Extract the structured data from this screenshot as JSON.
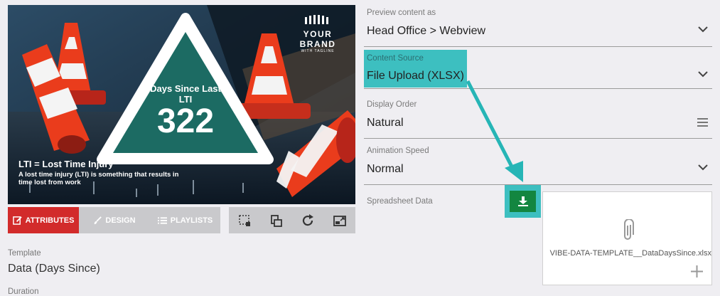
{
  "preview": {
    "brand_name": "YOUR BRAND",
    "brand_tagline": "WITH TAGLINE",
    "triangle_title": "Days Since Last LTI",
    "triangle_value": "322",
    "footer_heading": "LTI = Lost Time Injury",
    "footer_text": "A lost time injury (LTI) is something that results in time lost from work"
  },
  "tabs": [
    {
      "label": "ATTRIBUTES",
      "icon": "edit-icon",
      "active": true
    },
    {
      "label": "DESIGN",
      "icon": "brush-icon",
      "active": false
    },
    {
      "label": "PLAYLISTS",
      "icon": "list-icon",
      "active": false
    }
  ],
  "tools": [
    "crop-icon",
    "layers-icon",
    "refresh-icon",
    "fullscreen-icon"
  ],
  "template": {
    "label": "Template",
    "value": "Data (Days Since)"
  },
  "duration": {
    "label": "Duration"
  },
  "settings": {
    "preview_as": {
      "label": "Preview content as",
      "value": "Head Office > Webview"
    },
    "content_source": {
      "label": "Content Source",
      "value": "File Upload (XLSX)"
    },
    "display_order": {
      "label": "Display Order",
      "value": "Natural"
    },
    "animation_speed": {
      "label": "Animation Speed",
      "value": "Normal"
    }
  },
  "spreadsheet": {
    "label": "Spreadsheet Data",
    "filename": "VIBE-DATA-TEMPLATE__DataDaysSince.xlsx"
  },
  "colors": {
    "accent_red": "#d22b2b",
    "highlight_teal": "#3dbfc0",
    "download_green": "#138640",
    "triangle_green": "#1c6b63"
  }
}
